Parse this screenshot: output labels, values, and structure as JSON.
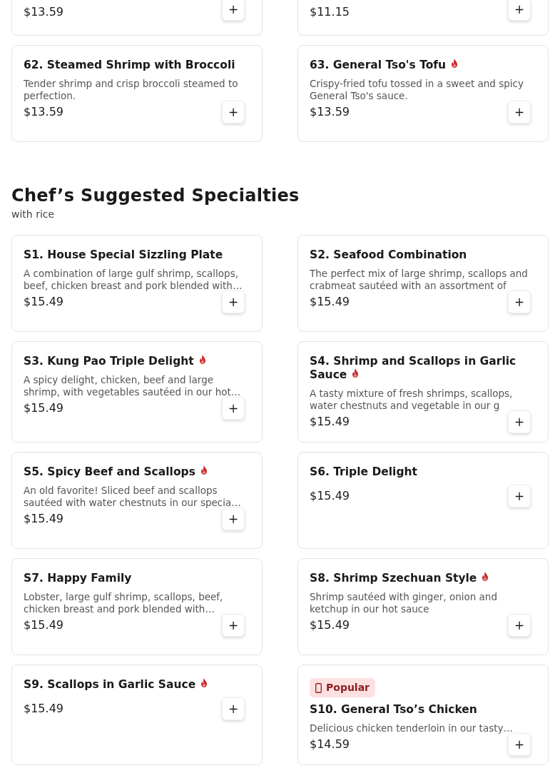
{
  "top_items": [
    {
      "price": "$13.59"
    },
    {
      "price": "$11.15"
    }
  ],
  "items_before": [
    {
      "title": "62. Steamed Shrimp with Broccoli",
      "spicy": false,
      "description": "Tender shrimp and crisp broccoli steamed to perfection.",
      "price": "$13.59"
    },
    {
      "title": "63. General Tso's Tofu",
      "spicy": true,
      "description": "Crispy-fried tofu tossed in a sweet and spicy General Tso's sauce.",
      "price": "$13.59"
    }
  ],
  "section": {
    "title": "Chef’s Suggested Specialties",
    "subtitle": "with rice"
  },
  "items": [
    {
      "title": "S1. House Special Sizzling Plate",
      "spicy": false,
      "description": "A combination of large gulf shrimp, scallops, beef, chicken breast and pork blended with…",
      "price": "$15.49"
    },
    {
      "title": "S2. Seafood Combination",
      "spicy": false,
      "description": "The perfect mix of large shrimp, scallops and crabmeat sautéed with an assortment of",
      "price": "$15.49"
    },
    {
      "title": "S3. Kung Pao Triple Delight",
      "spicy": true,
      "description": "A spicy delight, chicken, beef and large shrimp, with vegetables sautéed in our hot…",
      "price": "$15.49"
    },
    {
      "title": "S4. Shrimp and Scallops in Garlic Sauce",
      "spicy": true,
      "description": "A tasty mixture of fresh shrimps, scallops, water chestnuts and vegetable in our g",
      "price": "$15.49"
    },
    {
      "title": "S5. Spicy Beef and Scallops",
      "spicy": true,
      "description": "An old favorite! Sliced beef and scallops sautéed with water chestnuts in our specia…",
      "price": "$15.49"
    },
    {
      "title": "S6. Triple Delight",
      "spicy": false,
      "price": "$15.49"
    },
    {
      "title": "S7. Happy Family",
      "spicy": false,
      "description": "Lobster, large gulf shrimp, scallops, beef, chicken breast and pork blended with…",
      "price": "$15.49"
    },
    {
      "title": "S8. Shrimp Szechuan Style",
      "spicy": true,
      "description": "Shrimp sautéed with ginger, onion and ketchup in our hot sauce",
      "price": "$15.49"
    },
    {
      "title": "S9. Scallops in Garlic Sauce",
      "spicy": true,
      "price": "$15.49"
    },
    {
      "badge": "Popular",
      "title": "S10. General Tso’s Chicken",
      "spicy": false,
      "description": "Delicious chicken tenderloin in our tasty…",
      "price": "$14.59"
    }
  ],
  "add_button_label": "+"
}
